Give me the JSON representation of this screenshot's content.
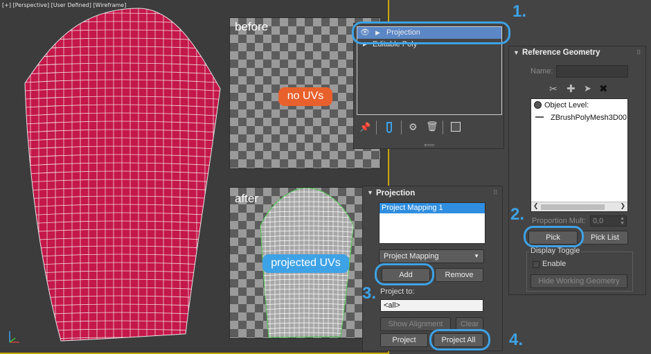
{
  "viewport": {
    "label": "[+] [Perspective] [User Defined] [Wireframe]"
  },
  "before_panel": {
    "title": "before",
    "badge": "no UVs",
    "badge_color": "#e8602c"
  },
  "after_panel": {
    "title": "after",
    "badge": "projected UVs",
    "badge_color": "#3ea2e6"
  },
  "modifier_stack": {
    "items": [
      {
        "label": "Projection",
        "selected": true
      },
      {
        "label": "Editable Poly",
        "selected": false
      }
    ]
  },
  "projection_rollout": {
    "title": "Projection",
    "list_items": [
      "Project Mapping 1"
    ],
    "type_dropdown": "Project Mapping",
    "add_label": "Add",
    "remove_label": "Remove",
    "project_to_label": "Project to:",
    "project_to_value": "<all>",
    "show_alignment_label": "Show Alignment",
    "clear_label": "Clear",
    "project_label": "Project",
    "project_all_label": "Project All"
  },
  "reference_rollout": {
    "title": "Reference Geometry",
    "name_label": "Name:",
    "name_value": "",
    "list_items": [
      "Object Level:",
      "ZBrushPolyMesh3D00"
    ],
    "proportion_label": "Proportion Mult:",
    "proportion_value": "0,0",
    "pick_label": "Pick",
    "pick_list_label": "Pick List",
    "display_toggle_label": "Display Toggle",
    "enable_label": "Enable",
    "hide_label": "Hide Working Geometry"
  },
  "steps": [
    "1.",
    "2.",
    "3.",
    "4."
  ],
  "colors": {
    "accent": "#3ea2e6",
    "mesh": "#c4174a",
    "selection": "#5b87c6",
    "viewport_border": "#c9a800"
  }
}
